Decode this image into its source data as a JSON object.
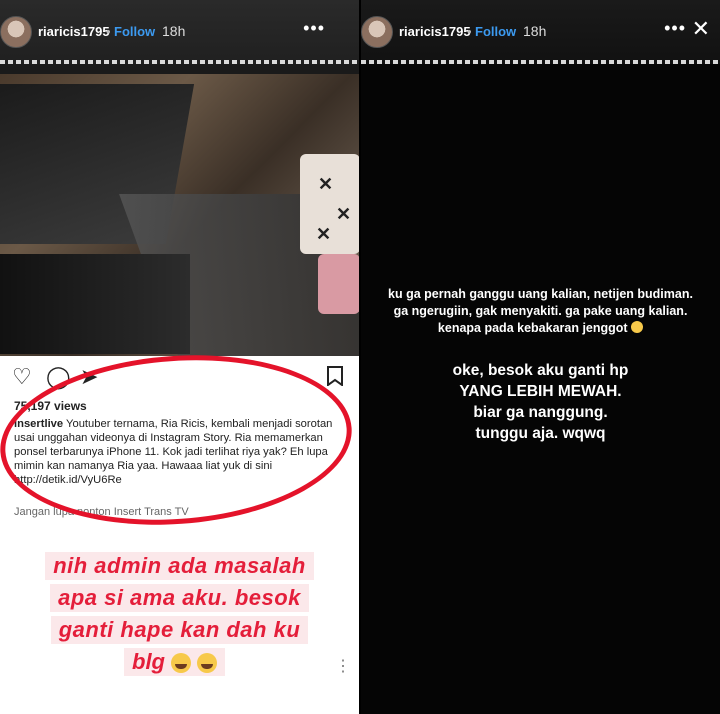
{
  "left_story": {
    "header": {
      "username": "riaricis1795",
      "separator": "•",
      "follow": "Follow",
      "time": "18h",
      "more_icon": "more-horizontal-icon",
      "close_icon": "close-icon"
    },
    "post": {
      "views": "75,197 views",
      "caption_user": "insertlive",
      "caption_text": " Youtuber ternama, Ria Ricis, kembali menjadi sorotan usai unggahan videonya di Instagram Story. Ria memamerkan ponsel terbarunya iPhone 11. Kok jadi terlihat riya yak?  Eh lupa mimin kan namanya Ria yaa. Hawaaa liat yuk di sini  http://detik.id/VyU6Re",
      "more_caption": "Jangan lupa nonton Insert Trans TV",
      "icons": [
        "heart-icon",
        "comment-icon",
        "share-icon",
        "bookmark-icon"
      ]
    },
    "sticker_lines": [
      "nih admin ada masalah",
      "apa si ama aku. besok",
      "ganti hape kan dah ku"
    ],
    "sticker_last": "blg",
    "highlight_color": "#e4132a"
  },
  "right_story": {
    "header": {
      "username": "riaricis1795",
      "separator": "•",
      "follow": "Follow",
      "time": "18h",
      "more_icon": "more-horizontal-icon",
      "close_icon": "close-icon"
    },
    "text_small": "ku ga pernah ganggu uang kalian, netijen budiman. ga ngerugiin, gak menyakiti. ga pake uang kalian. kenapa pada kebakaran jenggot",
    "text_big_lines": [
      "oke, besok aku ganti hp",
      "YANG LEBIH MEWAH.",
      "biar ga nanggung.",
      "tunggu aja. wqwq"
    ]
  }
}
